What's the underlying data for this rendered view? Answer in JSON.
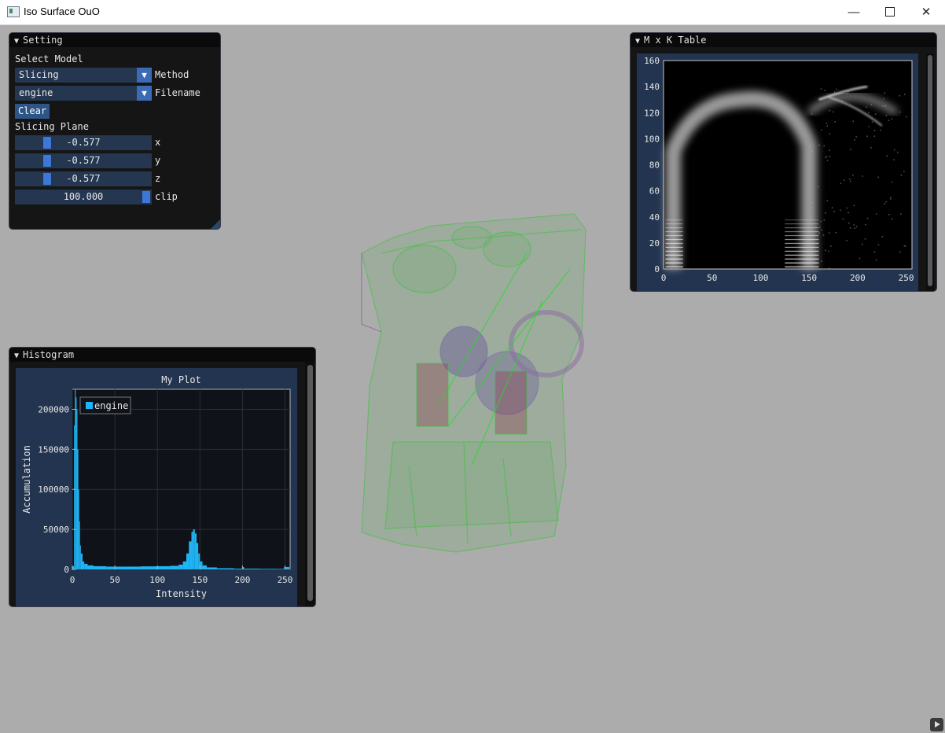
{
  "window": {
    "title": "Iso Surface OuO"
  },
  "setting": {
    "title": "Setting",
    "select_model_label": "Select Model",
    "method": {
      "value": "Slicing",
      "label": "Method"
    },
    "filename": {
      "value": "engine",
      "label": "Filename"
    },
    "clear_label": "Clear",
    "slicing_plane_label": "Slicing Plane",
    "sliders": [
      {
        "value": "-0.577",
        "label": "x",
        "fraction": 0.21
      },
      {
        "value": "-0.577",
        "label": "y",
        "fraction": 0.21
      },
      {
        "value": "-0.577",
        "label": "z",
        "fraction": 0.21
      },
      {
        "value": "100.000",
        "label": "clip",
        "fraction": 1.0
      }
    ]
  },
  "mxk": {
    "title": "M x K Table",
    "chart_data": {
      "type": "heatmap",
      "xlim": [
        0,
        256
      ],
      "ylim": [
        0,
        160
      ],
      "x_ticks": [
        "0",
        "50",
        "100",
        "150",
        "200",
        "250"
      ],
      "y_ticks": [
        "0",
        "20",
        "40",
        "60",
        "80",
        "100",
        "120",
        "140",
        "160"
      ]
    }
  },
  "histogram": {
    "title": "Histogram",
    "chart_data": {
      "type": "bar",
      "title": "My Plot",
      "xlabel": "Intensity",
      "ylabel": "Accumulation",
      "xlim": [
        0,
        256
      ],
      "ylim": [
        0,
        225000
      ],
      "x_ticks": [
        "0",
        "50",
        "100",
        "150",
        "200",
        "250"
      ],
      "y_ticks": [
        "0",
        "50000",
        "100000",
        "150000",
        "200000"
      ],
      "grid": true,
      "legend_position": "top-left",
      "series": [
        {
          "name": "engine",
          "color": "#1fb4f5",
          "points": [
            [
              0,
              4000
            ],
            [
              2,
              180000
            ],
            [
              3,
              225000
            ],
            [
              4,
              215000
            ],
            [
              5,
              200000
            ],
            [
              6,
              150000
            ],
            [
              7,
              100000
            ],
            [
              8,
              60000
            ],
            [
              9,
              30000
            ],
            [
              10,
              20000
            ],
            [
              12,
              10000
            ],
            [
              14,
              7000
            ],
            [
              18,
              5000
            ],
            [
              25,
              4000
            ],
            [
              40,
              3500
            ],
            [
              60,
              3500
            ],
            [
              80,
              3800
            ],
            [
              100,
              4000
            ],
            [
              115,
              4500
            ],
            [
              125,
              6000
            ],
            [
              130,
              10000
            ],
            [
              134,
              20000
            ],
            [
              137,
              35000
            ],
            [
              140,
              47000
            ],
            [
              142,
              50000
            ],
            [
              144,
              45000
            ],
            [
              146,
              33000
            ],
            [
              148,
              20000
            ],
            [
              150,
              10000
            ],
            [
              153,
              5000
            ],
            [
              158,
              2500
            ],
            [
              170,
              1500
            ],
            [
              190,
              1000
            ],
            [
              200,
              3000
            ],
            [
              202,
              1000
            ],
            [
              220,
              800
            ],
            [
              240,
              700
            ],
            [
              249,
              3000
            ],
            [
              255,
              500
            ]
          ]
        }
      ]
    }
  }
}
